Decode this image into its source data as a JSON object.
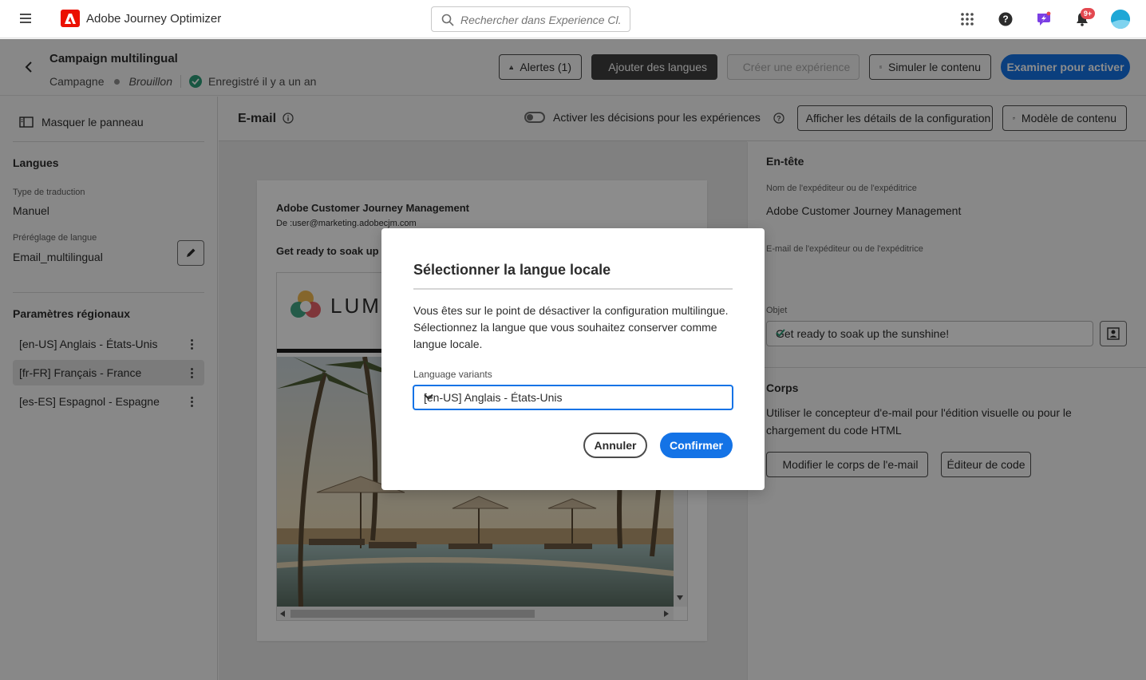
{
  "app": {
    "name": "Adobe Journey Optimizer",
    "notification_count": "9+"
  },
  "search": {
    "placeholder": "Rechercher dans Experience Cl..."
  },
  "campaign": {
    "title": "Campaign multilingual",
    "type": "Campagne",
    "status": "Brouillon",
    "saved": "Enregistré il y a un an"
  },
  "toolbar": {
    "alerts": "Alertes (1)",
    "add_languages": "Ajouter des langues",
    "create_experience": "Créer une expérience",
    "simulate": "Simuler le contenu",
    "review": "Examiner pour activer"
  },
  "left_panel": {
    "hide_panel": "Masquer le panneau",
    "languages_heading": "Langues",
    "translation_type_label": "Type de traduction",
    "translation_type_value": "Manuel",
    "language_preset_label": "Préréglage de langue",
    "language_preset_value": "Email_multilingual",
    "regional_heading": "Paramètres régionaux",
    "locales": [
      {
        "label": "[en-US] Anglais - États-Unis",
        "selected": false
      },
      {
        "label": "[fr-FR] Français - France",
        "selected": true
      },
      {
        "label": "[es-ES] Espagnol - Espagne",
        "selected": false
      }
    ]
  },
  "center": {
    "title": "E-mail",
    "decisions_toggle": "Activer les décisions pour les expériences",
    "config_details": "Afficher les détails de la configuration",
    "content_template": "Modèle de contenu",
    "preview": {
      "from_name": "Adobe Customer Journey Management",
      "from_address": "De :user@marketing.adobecjm.com",
      "subject": "Get ready to soak up th",
      "logo_text": "LUMA"
    }
  },
  "right_panel": {
    "header_heading": "En-tête",
    "sender_name_label": "Nom de l'expéditeur ou de l'expéditrice",
    "sender_name_value": "Adobe Customer Journey Management",
    "sender_email_label": "E-mail de l'expéditeur ou de l'expéditrice",
    "subject_label": "Objet",
    "subject_value": "Get ready to soak up the sunshine!",
    "body_heading": "Corps",
    "body_text": "Utiliser le concepteur d'e-mail pour l'édition visuelle ou pour le chargement du code HTML",
    "edit_body": "Modifier le corps de l'e-mail",
    "code_editor": "Éditeur de code"
  },
  "modal": {
    "title": "Sélectionner la langue locale",
    "body": "Vous êtes sur le point de désactiver la configuration multilingue. Sélectionnez la langue que vous souhaitez conserver comme langue locale.",
    "select_label": "Language variants",
    "select_value": "[en-US] Anglais - États-Unis",
    "cancel": "Annuler",
    "confirm": "Confirmer"
  },
  "colors": {
    "accent": "#1473e6",
    "brand": "#eb1000",
    "success": "#2d9d78",
    "alert_badge": "#e34850"
  }
}
